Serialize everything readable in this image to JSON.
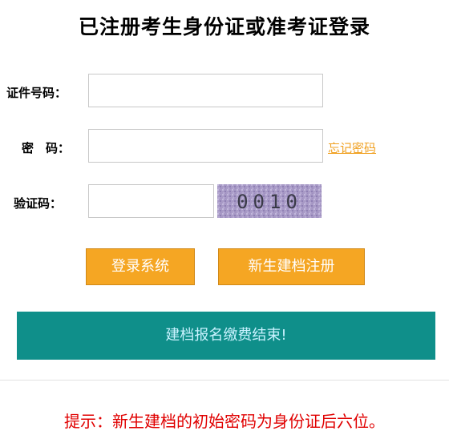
{
  "page": {
    "title": "已注册考生身份证或准考证登录"
  },
  "form": {
    "id_label": "证件号码：",
    "id_value": "",
    "password_label": "密　码：",
    "password_value": "",
    "forgot_password": "忘记密码",
    "captcha_label": "验证码：",
    "captcha_value": "",
    "captcha_text": "0010"
  },
  "buttons": {
    "login": "登录系统",
    "register": "新生建档注册"
  },
  "banner": {
    "text": "建档报名缴费结束!"
  },
  "tip": {
    "text": "提示：新生建档的初始密码为身份证后六位。"
  },
  "colors": {
    "button": "#f5a623",
    "banner": "#0f8f8a",
    "banner_text": "#c9f2ff",
    "link": "#f0a020",
    "tip": "#e00000"
  }
}
